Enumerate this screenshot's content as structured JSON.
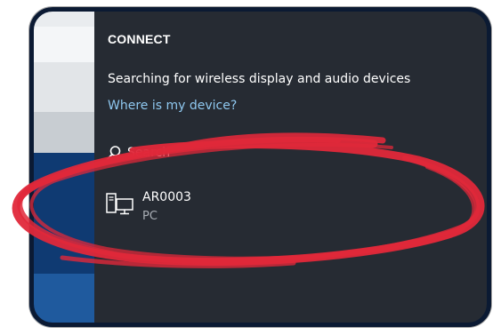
{
  "panel": {
    "title": "CONNECT",
    "status_text": "Searching for wireless display and audio devices",
    "help_link": "Where is my device?",
    "search_label": "Search"
  },
  "devices": [
    {
      "name": "AR0003",
      "type": "PC",
      "icon": "pc-monitor-icon"
    }
  ],
  "colors": {
    "panel_bg": "#262b33",
    "link": "#8fc8f0",
    "annotation": "#e0283a",
    "frame_border": "#0b1a33"
  },
  "icons": [
    "search-icon",
    "pc-monitor-icon"
  ]
}
